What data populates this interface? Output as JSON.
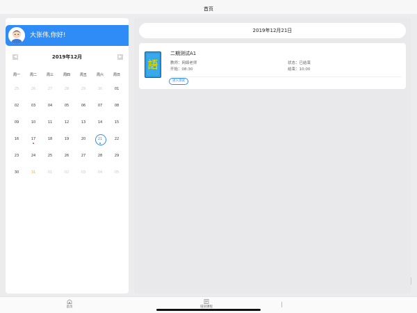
{
  "topbar": {
    "title": "首页"
  },
  "greeting": {
    "text": "大张伟,你好!"
  },
  "calendar": {
    "title": "2019年12月",
    "prev_icon": "chevron-left-icon",
    "next_icon": "chevron-right-icon",
    "weekdays": [
      "周一",
      "周二",
      "周三",
      "周四",
      "周五",
      "周六",
      "周日"
    ],
    "days": [
      {
        "label": "25",
        "muted": true
      },
      {
        "label": "26",
        "muted": true
      },
      {
        "label": "27",
        "muted": true
      },
      {
        "label": "28",
        "muted": true
      },
      {
        "label": "29",
        "muted": true
      },
      {
        "label": "30",
        "muted": true
      },
      {
        "label": "01"
      },
      {
        "label": "02"
      },
      {
        "label": "03"
      },
      {
        "label": "04"
      },
      {
        "label": "05"
      },
      {
        "label": "06"
      },
      {
        "label": "07"
      },
      {
        "label": "08"
      },
      {
        "label": "09"
      },
      {
        "label": "10"
      },
      {
        "label": "11"
      },
      {
        "label": "12"
      },
      {
        "label": "13"
      },
      {
        "label": "14"
      },
      {
        "label": "15"
      },
      {
        "label": "16"
      },
      {
        "label": "17",
        "mark": "red"
      },
      {
        "label": "18"
      },
      {
        "label": "19"
      },
      {
        "label": "20"
      },
      {
        "label": "21",
        "selected": true,
        "mark": "blue"
      },
      {
        "label": "22"
      },
      {
        "label": "23"
      },
      {
        "label": "24"
      },
      {
        "label": "25"
      },
      {
        "label": "26"
      },
      {
        "label": "27"
      },
      {
        "label": "28"
      },
      {
        "label": "29"
      },
      {
        "label": "30"
      },
      {
        "label": "31",
        "today": true
      },
      {
        "label": "01",
        "muted": true
      },
      {
        "label": "02",
        "muted": true
      },
      {
        "label": "03",
        "muted": true
      },
      {
        "label": "04",
        "muted": true
      },
      {
        "label": "05",
        "muted": true
      }
    ]
  },
  "detail": {
    "date": "2019年12月21日",
    "exam": {
      "title": "二期测试A1",
      "teacher": "教师：网络老师",
      "start": "开始：08:30",
      "status": "状态：已结束",
      "end": "结束：10:00",
      "button": "进入测试",
      "icon": "book-icon"
    }
  },
  "tabs": [
    {
      "label": "首页",
      "icon": "home-icon"
    },
    {
      "label": "培训课程",
      "icon": "records-icon"
    }
  ],
  "colors": {
    "accent": "#2f8cf6",
    "today": "#f0a93a",
    "mark_red": "#e0443b"
  }
}
